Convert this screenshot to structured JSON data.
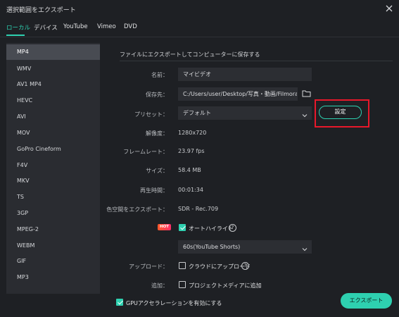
{
  "window": {
    "title": "選択範囲をエクスポート"
  },
  "tabs": [
    "ローカル",
    "デバイス",
    "YouTube",
    "Vimeo",
    "DVD"
  ],
  "formats": [
    "MP4",
    "WMV",
    "AV1 MP4",
    "HEVC",
    "AVI",
    "MOV",
    "GoPro Cineform",
    "F4V",
    "MKV",
    "TS",
    "3GP",
    "MPEG-2",
    "WEBM",
    "GIF",
    "MP3"
  ],
  "selected_format": "MP4",
  "section_title": "ファイルにエクスポートしてコンピューターに保存する",
  "fields": {
    "name_label": "名前：",
    "name_value": "マイビデオ",
    "save_label": "保存先：",
    "save_value": "C:/Users/user/Desktop/写真・動画/Filmora/",
    "preset_label": "プリセット：",
    "preset_value": "デフォルト",
    "settings_button": "設定",
    "resolution_label": "解像度：",
    "resolution_value": "1280x720",
    "framerate_label": "フレームレート：",
    "framerate_value": "23.97 fps",
    "size_label": "サイズ：",
    "size_value": "58.4 MB",
    "duration_label": "再生時間：",
    "duration_value": "00:01:34",
    "colorspace_label": "色空間をエクスポート：",
    "colorspace_value": "SDR - Rec.709"
  },
  "auto_highlight": {
    "badge": "HOT",
    "label": "オートハイライト",
    "checked": true,
    "dropdown_value": "60s(YouTube Shorts)"
  },
  "upload": {
    "label": "アップロード：",
    "option": "クラウドにアップロード",
    "checked": false
  },
  "add": {
    "label": "追加：",
    "option": "プロジェクトメディアに追加",
    "checked": false
  },
  "gpu": {
    "label": "GPUアクセラレーションを有効にする",
    "checked": true
  },
  "export_button": "エクスポート",
  "colors": {
    "accent": "#2ed0b0",
    "background": "#1e2024",
    "sidebar": "#2a2c31",
    "selected": "#484b52",
    "highlight_box": "#e8182a"
  },
  "icons": {
    "close": "close-icon",
    "folder": "folder-icon",
    "chevron": "chevron-down-icon",
    "help": "help-icon"
  }
}
